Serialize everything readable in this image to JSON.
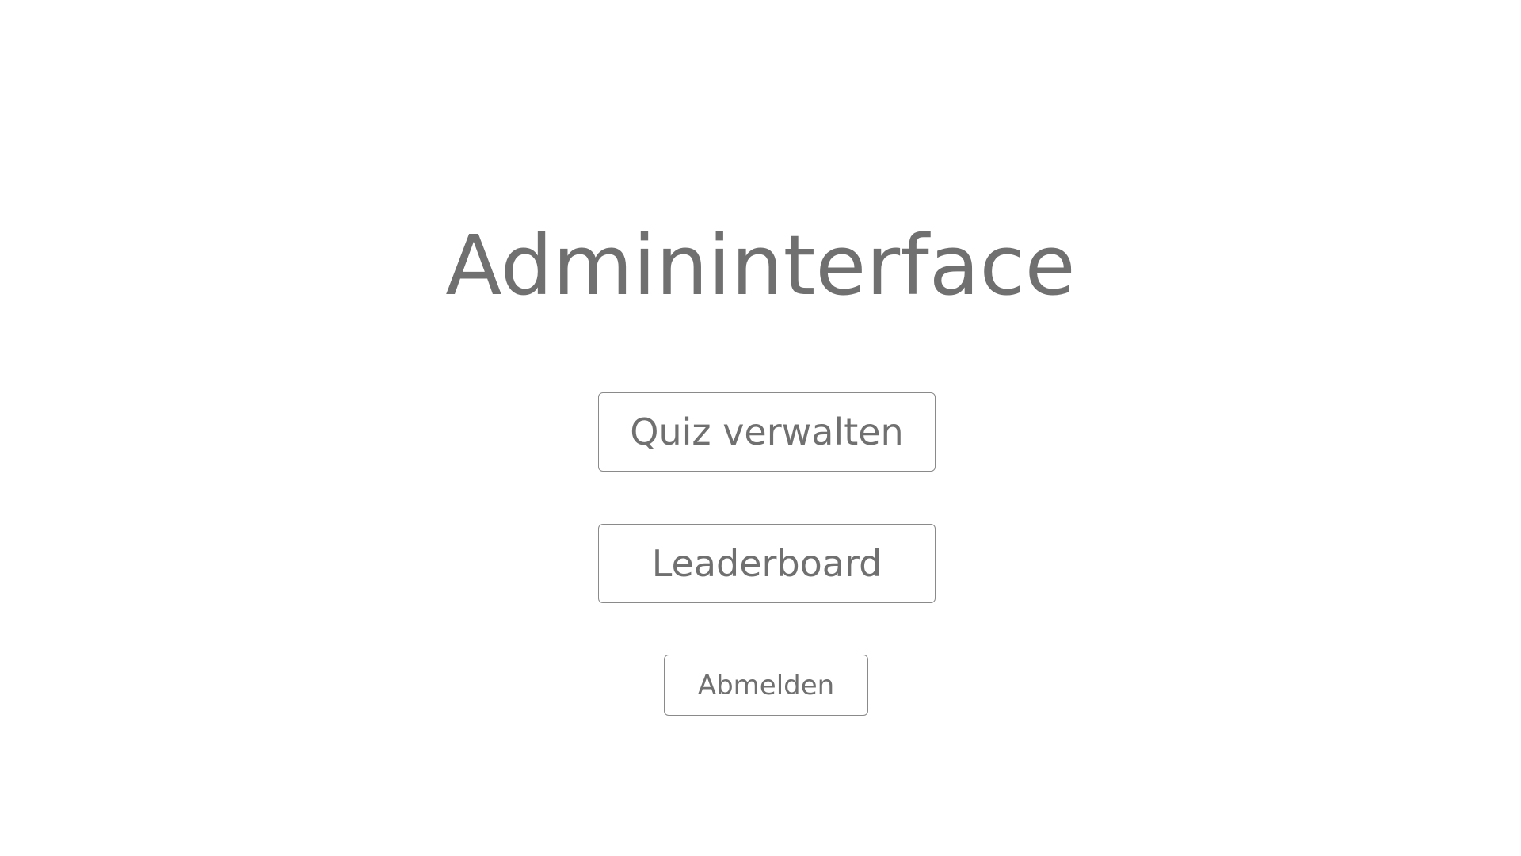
{
  "page": {
    "title": "Admininterface"
  },
  "actions": {
    "manage_quiz_label": "Quiz verwalten",
    "leaderboard_label": "Leaderboard",
    "logout_label": "Abmelden"
  },
  "colors": {
    "background": "#ffffff",
    "text": "#707070",
    "border": "#8a8a8a"
  }
}
